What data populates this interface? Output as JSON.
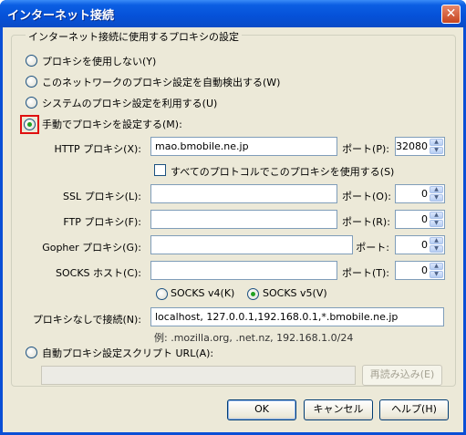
{
  "window": {
    "title": "インターネット接続",
    "close_glyph": "✕"
  },
  "group": {
    "label": "インターネット接続に使用するプロキシの設定"
  },
  "options": {
    "no_proxy": "プロキシを使用しない(Y)",
    "auto_detect": "このネットワークのプロキシ設定を自動検出する(W)",
    "system": "システムのプロキシ設定を利用する(U)",
    "manual": "手動でプロキシを設定する(M):",
    "pac": "自動プロキシ設定スクリプト URL(A):",
    "selected": "manual"
  },
  "proxies": {
    "http": {
      "label": "HTTP プロキシ(X):",
      "host": "mao.bmobile.ne.jp",
      "port_label": "ポート(P):",
      "port": "32080"
    },
    "use_all": "すべてのプロトコルでこのプロキシを使用する(S)",
    "ssl": {
      "label": "SSL プロキシ(L):",
      "host": "",
      "port_label": "ポート(O):",
      "port": "0"
    },
    "ftp": {
      "label": "FTP プロキシ(F):",
      "host": "",
      "port_label": "ポート(R):",
      "port": "0"
    },
    "gopher": {
      "label": "Gopher プロキシ(G):",
      "host": "",
      "port_label": "ポート:",
      "port": "0"
    },
    "socks": {
      "label": "SOCKS ホスト(C):",
      "host": "",
      "port_label": "ポート(T):",
      "port": "0"
    },
    "socks_v4": "SOCKS v4(K)",
    "socks_v5": "SOCKS v5(V)",
    "socks_selected": "v5"
  },
  "no_proxy_for": {
    "label": "プロキシなしで接続(N):",
    "value": "localhost, 127.0.0.1,192.168.0.1,*.bmobile.ne.jp",
    "example": "例: .mozilla.org, .net.nz, 192.168.1.0/24"
  },
  "pac": {
    "url": "",
    "reload_label": "再読み込み(E)"
  },
  "buttons": {
    "ok": "OK",
    "cancel": "キャンセル",
    "help": "ヘルプ(H)"
  },
  "colors": {
    "title_bar": "#0551d8",
    "dialog_bg": "#ece9d8",
    "highlight": "#e01010"
  }
}
